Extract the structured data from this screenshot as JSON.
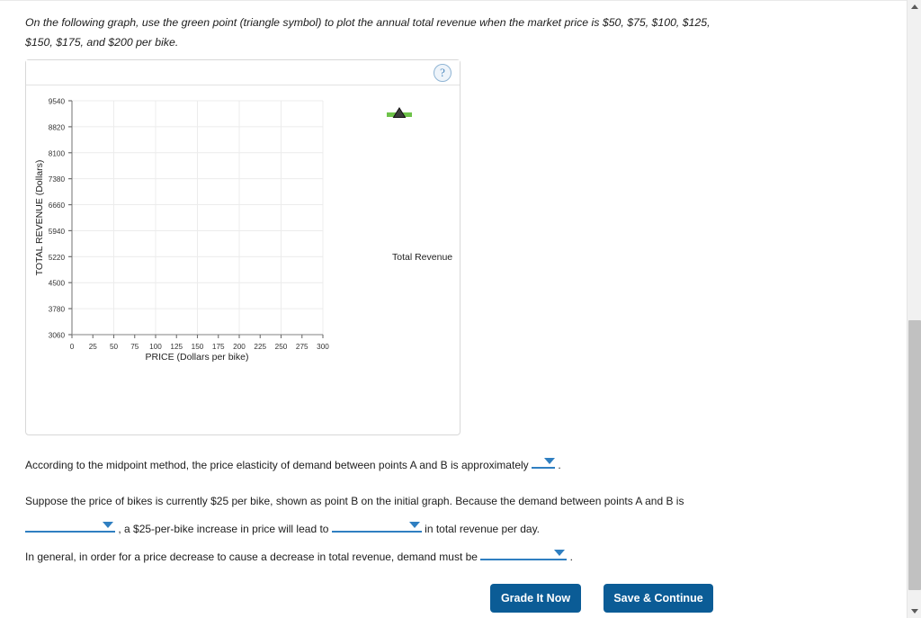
{
  "prompt": "On the following graph, use the green point (triangle symbol) to plot the annual total revenue when the market price is $50, $75, $100, $125, $150, $175, and $200 per bike.",
  "panel": {
    "help_icon": "?"
  },
  "chart_data": {
    "type": "scatter",
    "title": "",
    "xlabel": "PRICE (Dollars per bike)",
    "ylabel": "TOTAL REVENUE (Dollars)",
    "x_ticks": [
      0,
      25,
      50,
      75,
      100,
      125,
      150,
      175,
      200,
      225,
      250,
      275,
      300
    ],
    "x_tick_labels": [
      "0",
      "25",
      "50",
      "75",
      "100",
      "125",
      "150",
      "175",
      "200",
      "225",
      "250",
      "275",
      "300"
    ],
    "y_ticks": [
      3060,
      3780,
      4500,
      5220,
      5940,
      6660,
      7380,
      8100,
      8820,
      9540
    ],
    "y_tick_labels": [
      "3060",
      "3780",
      "4500",
      "5220",
      "5940",
      "6660",
      "7380",
      "8100",
      "8820",
      "9540"
    ],
    "xlim": [
      0,
      300
    ],
    "ylim": [
      3060,
      9540
    ],
    "grid": true,
    "legend_position": "right",
    "series": [
      {
        "name": "Total Revenue",
        "marker": "triangle",
        "marker_color": "#000000",
        "line_color": "#6ec24a",
        "values": []
      }
    ]
  },
  "legend": {
    "total_revenue_label": "Total Revenue"
  },
  "questions": {
    "q1_part1": "According to the midpoint method, the price elasticity of demand between points A and B is approximately",
    "q1_period": ".",
    "q2_part1": "Suppose the price of bikes is currently $25 per bike, shown as point B on the initial graph. Because the demand between points A and B is",
    "q2_part2": ", a $25-per-bike increase in price will lead to",
    "q2_part3": "in total revenue per day.",
    "q3_part1": "In general, in order for a price decrease to cause a decrease in total revenue, demand must be",
    "q3_period": "."
  },
  "buttons": {
    "grade": "Grade It Now",
    "save": "Save & Continue"
  },
  "scrollbar": {
    "up_arrow": "▲",
    "down_arrow": "▼"
  },
  "colors": {
    "button_blue": "#0b5c96",
    "dropdown_blue": "#2f7fc1",
    "series_green": "#6ec24a",
    "help_blue": "#4a86bd"
  }
}
